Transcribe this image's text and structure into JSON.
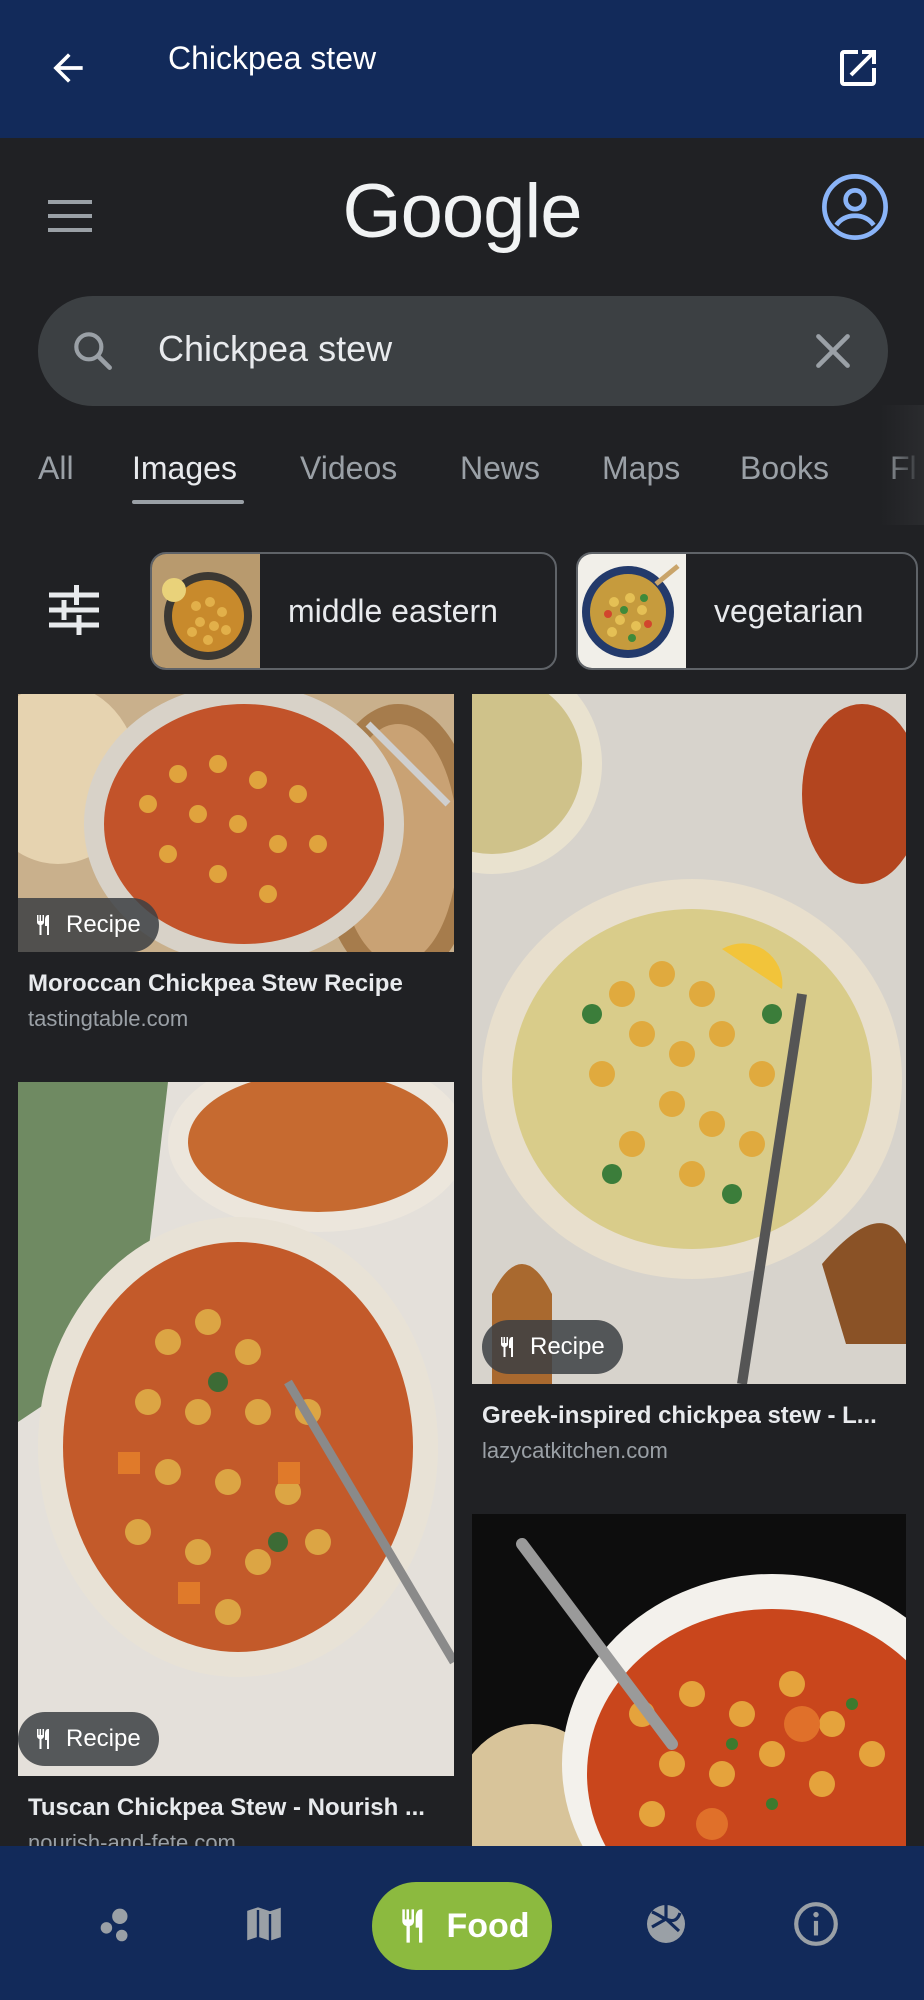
{
  "appbar": {
    "title": "Chickpea stew",
    "back_icon": "arrow-left-icon",
    "open_icon": "open-in-new-icon",
    "color": "#122a5a"
  },
  "google": {
    "logo_text": "Google",
    "account_icon": "account-circle-icon",
    "account_color": "#8ab4f8"
  },
  "search": {
    "query": "Chickpea stew",
    "search_icon": "search-icon",
    "clear_icon": "close-icon"
  },
  "tabs": [
    {
      "label": "All",
      "active": false
    },
    {
      "label": "Images",
      "active": true
    },
    {
      "label": "Videos",
      "active": false
    },
    {
      "label": "News",
      "active": false
    },
    {
      "label": "Maps",
      "active": false
    },
    {
      "label": "Books",
      "active": false
    },
    {
      "label": "Fl",
      "active": false
    }
  ],
  "chips": [
    {
      "label": "middle eastern"
    },
    {
      "label": "vegetarian"
    }
  ],
  "results": [
    {
      "title": "Moroccan Chickpea Stew Recipe",
      "source": "tastingtable.com",
      "badge": "Recipe"
    },
    {
      "title": "Greek-inspired chickpea stew - L...",
      "source": "lazycatkitchen.com",
      "badge": "Recipe"
    },
    {
      "title": "Tuscan Chickpea Stew - Nourish ...",
      "source": "nourish-and-fete.com",
      "badge": "Recipe"
    },
    {
      "title": "",
      "source": "",
      "badge": ""
    }
  ],
  "bottomnav": {
    "items": [
      {
        "icon": "scatter-dots-icon"
      },
      {
        "icon": "map-icon"
      },
      {
        "icon": "fork-knife-icon",
        "label": "Food",
        "active": true
      },
      {
        "icon": "volleyball-icon"
      },
      {
        "icon": "info-icon"
      }
    ],
    "active_color": "#8cba3f"
  }
}
